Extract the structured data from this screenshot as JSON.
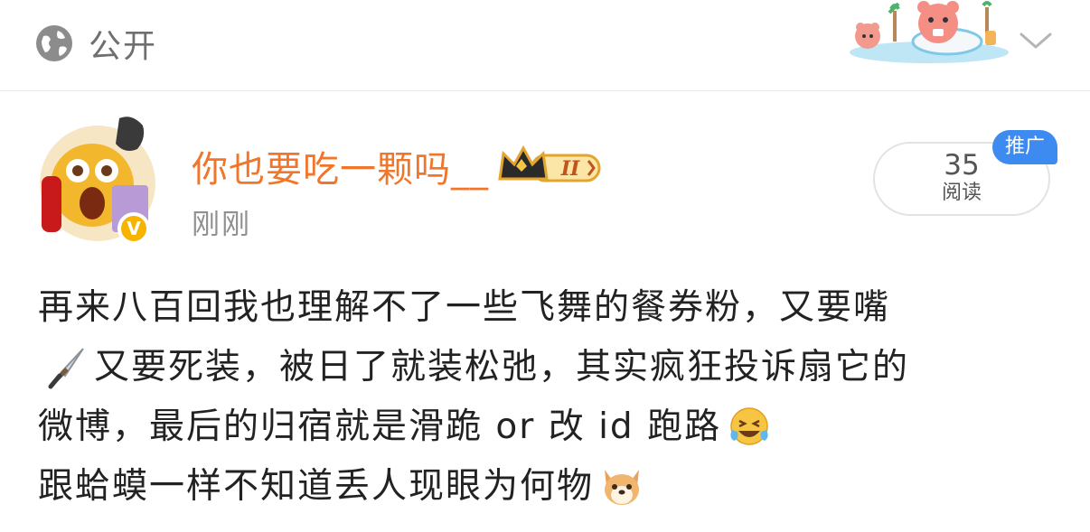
{
  "header": {
    "visibility_label": "公开",
    "icons": {
      "visibility": "globe-icon",
      "expand": "chevron-down-icon"
    }
  },
  "author": {
    "name": "你也要吃一颗吗__",
    "time": "刚刚",
    "badge_level": "II",
    "verified_mark": "V"
  },
  "stats": {
    "read_count": "35",
    "read_label": "阅读",
    "promo_label": "推广"
  },
  "post": {
    "line1": "再来八百回我也理解不了一些飞舞的餐券粉，又要嘴",
    "line2": "又要死装，被日了就装松弛，其实疯狂投诉扇它的",
    "line3": "微博，最后的归宿就是滑跪 or 改 id 跑路",
    "line4": "跟蛤蟆一样不知道丢人现眼为何物",
    "emojis": [
      "sword-icon",
      "laughing-tears-icon",
      "dog-face-icon"
    ]
  },
  "colors": {
    "author_name": "#f0762b",
    "promo_badge": "#3d8bf0",
    "secondary_text": "#909090"
  }
}
